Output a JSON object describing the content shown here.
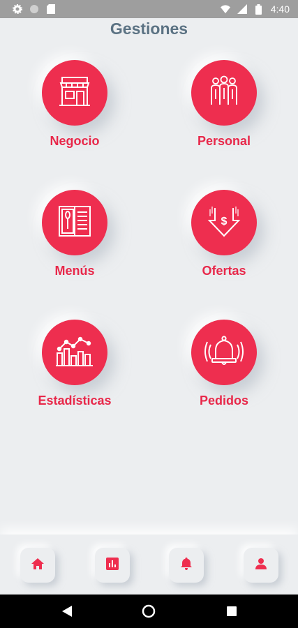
{
  "status_bar": {
    "time": "4:40",
    "left_icons": [
      "gear-icon",
      "circle-icon",
      "sd-card-icon"
    ],
    "right_icons": [
      "wifi-icon",
      "signal-icon",
      "battery-icon"
    ]
  },
  "header": {
    "title": "Gestiones"
  },
  "tiles": [
    {
      "label": "Negocio",
      "icon": "store-icon"
    },
    {
      "label": "Personal",
      "icon": "people-icon"
    },
    {
      "label": "Menús",
      "icon": "menu-icon"
    },
    {
      "label": "Ofertas",
      "icon": "dollar-down-icon"
    },
    {
      "label": "Estadísticas",
      "icon": "stats-chart-icon"
    },
    {
      "label": "Pedidos",
      "icon": "bell-ring-icon"
    }
  ],
  "bottom_nav": {
    "items": [
      "home-icon",
      "bar-chart-icon",
      "bell-icon",
      "user-icon"
    ]
  },
  "android_nav": [
    "back-icon",
    "home-circle-icon",
    "recents-icon"
  ],
  "colors": {
    "accent": "#ee2e4f",
    "label": "#e8284a",
    "title": "#5b7283",
    "background": "#eceef0"
  }
}
